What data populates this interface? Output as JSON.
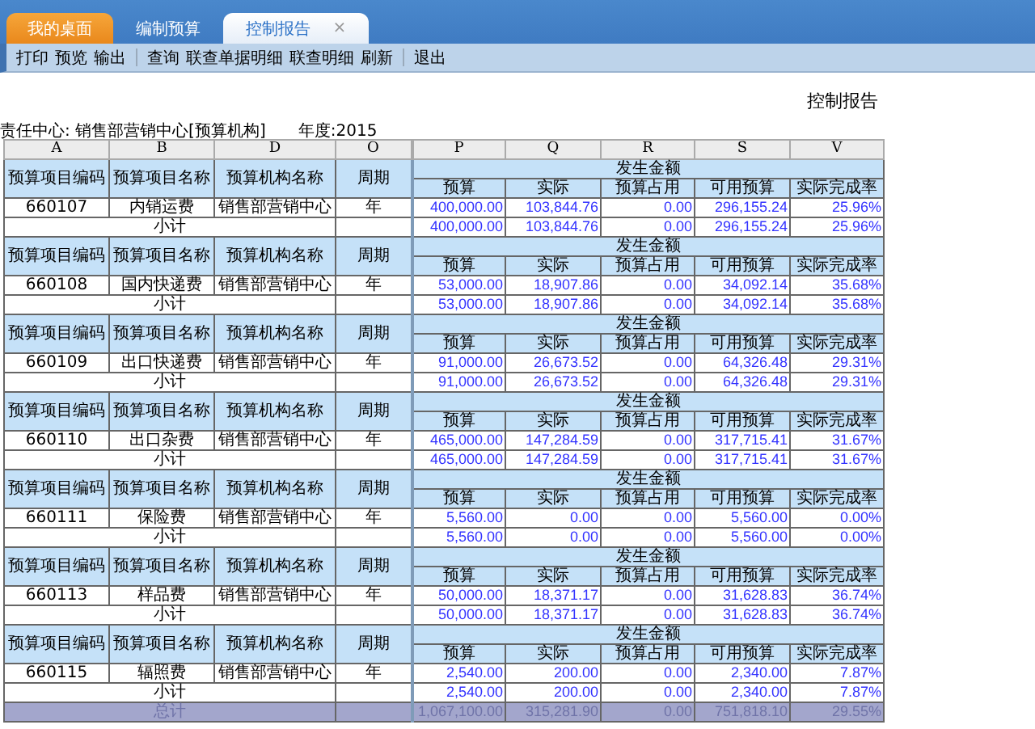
{
  "tabs": [
    {
      "label": "我的桌面",
      "kind": "home",
      "selected": false
    },
    {
      "label": "编制预算",
      "kind": "page",
      "selected": false
    },
    {
      "label": "控制报告",
      "kind": "page",
      "selected": true,
      "close": "×"
    }
  ],
  "toolbar": [
    {
      "buttons": [
        "打印",
        "预览",
        "输出"
      ]
    },
    {
      "buttons": [
        "查询",
        "联查单据明细",
        "联查明细",
        "刷新"
      ]
    },
    {
      "buttons": [
        "退出"
      ]
    }
  ],
  "report": {
    "title": "控制报告",
    "responsibility_center": "责任中心: 销售部营销中心[预算机构]",
    "year": "年度:2015"
  },
  "table": {
    "column_letters": [
      "A",
      "B",
      "D",
      "O",
      "P",
      "Q",
      "R",
      "S",
      "V"
    ],
    "groups": [
      {
        "headers": [
          "预算项目编码",
          "预算项目名称",
          "预算机构名称",
          "周期"
        ],
        "heading": "发生金额",
        "subheaders": [
          "预算",
          "实际",
          "预算占用",
          "可用预算",
          "实际完成率"
        ],
        "code": "660107",
        "name": "内销运费",
        "org": "销售部营销中心",
        "period": "年",
        "values": [
          "400,000.00",
          "103,844.76",
          "0.00",
          "296,155.24",
          "25.96%"
        ],
        "subtotal_label": "小计",
        "subtotal": [
          "400,000.00",
          "103,844.76",
          "0.00",
          "296,155.24",
          "25.96%"
        ]
      },
      {
        "headers": [
          "预算项目编码",
          "预算项目名称",
          "预算机构名称",
          "周期"
        ],
        "heading": "发生金额",
        "subheaders": [
          "预算",
          "实际",
          "预算占用",
          "可用预算",
          "实际完成率"
        ],
        "code": "660108",
        "name": "国内快递费",
        "org": "销售部营销中心",
        "period": "年",
        "values": [
          "53,000.00",
          "18,907.86",
          "0.00",
          "34,092.14",
          "35.68%"
        ],
        "subtotal_label": "小计",
        "subtotal": [
          "53,000.00",
          "18,907.86",
          "0.00",
          "34,092.14",
          "35.68%"
        ]
      },
      {
        "headers": [
          "预算项目编码",
          "预算项目名称",
          "预算机构名称",
          "周期"
        ],
        "heading": "发生金额",
        "subheaders": [
          "预算",
          "实际",
          "预算占用",
          "可用预算",
          "实际完成率"
        ],
        "code": "660109",
        "name": "出口快递费",
        "org": "销售部营销中心",
        "period": "年",
        "values": [
          "91,000.00",
          "26,673.52",
          "0.00",
          "64,326.48",
          "29.31%"
        ],
        "subtotal_label": "小计",
        "subtotal": [
          "91,000.00",
          "26,673.52",
          "0.00",
          "64,326.48",
          "29.31%"
        ]
      },
      {
        "headers": [
          "预算项目编码",
          "预算项目名称",
          "预算机构名称",
          "周期"
        ],
        "heading": "发生金额",
        "subheaders": [
          "预算",
          "实际",
          "预算占用",
          "可用预算",
          "实际完成率"
        ],
        "code": "660110",
        "name": "出口杂费",
        "org": "销售部营销中心",
        "period": "年",
        "values": [
          "465,000.00",
          "147,284.59",
          "0.00",
          "317,715.41",
          "31.67%"
        ],
        "subtotal_label": "小计",
        "subtotal": [
          "465,000.00",
          "147,284.59",
          "0.00",
          "317,715.41",
          "31.67%"
        ]
      },
      {
        "headers": [
          "预算项目编码",
          "预算项目名称",
          "预算机构名称",
          "周期"
        ],
        "heading": "发生金额",
        "subheaders": [
          "预算",
          "实际",
          "预算占用",
          "可用预算",
          "实际完成率"
        ],
        "code": "660111",
        "name": "保险费",
        "org": "销售部营销中心",
        "period": "年",
        "values": [
          "5,560.00",
          "0.00",
          "0.00",
          "5,560.00",
          "0.00%"
        ],
        "subtotal_label": "小计",
        "subtotal": [
          "5,560.00",
          "0.00",
          "0.00",
          "5,560.00",
          "0.00%"
        ]
      },
      {
        "headers": [
          "预算项目编码",
          "预算项目名称",
          "预算机构名称",
          "周期"
        ],
        "heading": "发生金额",
        "subheaders": [
          "预算",
          "实际",
          "预算占用",
          "可用预算",
          "实际完成率"
        ],
        "code": "660113",
        "name": "样品费",
        "org": "销售部营销中心",
        "period": "年",
        "values": [
          "50,000.00",
          "18,371.17",
          "0.00",
          "31,628.83",
          "36.74%"
        ],
        "subtotal_label": "小计",
        "subtotal": [
          "50,000.00",
          "18,371.17",
          "0.00",
          "31,628.83",
          "36.74%"
        ]
      },
      {
        "headers": [
          "预算项目编码",
          "预算项目名称",
          "预算机构名称",
          "周期"
        ],
        "heading": "发生金额",
        "subheaders": [
          "预算",
          "实际",
          "预算占用",
          "可用预算",
          "实际完成率"
        ],
        "code": "660115",
        "name": "辐照费",
        "org": "销售部营销中心",
        "period": "年",
        "values": [
          "2,540.00",
          "200.00",
          "0.00",
          "2,340.00",
          "7.87%"
        ],
        "subtotal_label": "小计",
        "subtotal": [
          "2,540.00",
          "200.00",
          "0.00",
          "2,340.00",
          "7.87%"
        ]
      }
    ],
    "total": {
      "label": "总计",
      "values": [
        "1,067,100.00",
        "315,281.90",
        "0.00",
        "751,818.10",
        "29.55%"
      ]
    }
  }
}
